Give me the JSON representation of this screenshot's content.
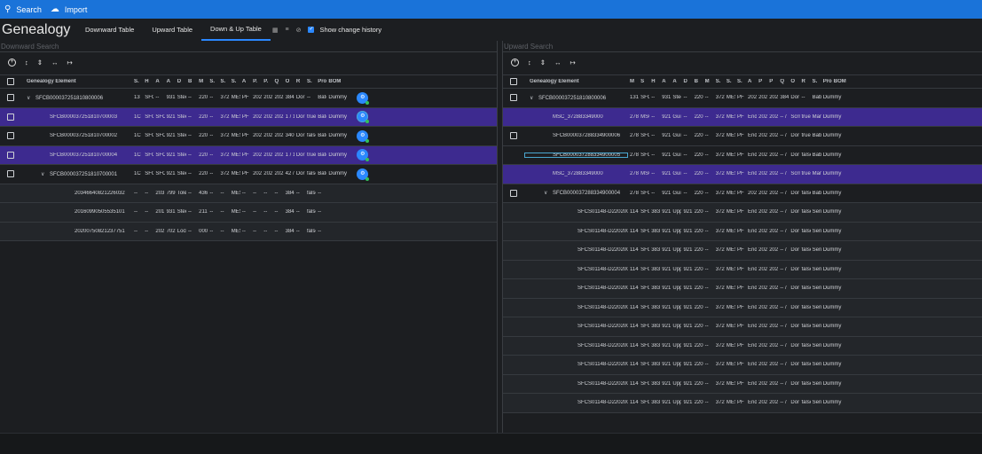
{
  "topbar": {
    "search_label": "Search",
    "import_label": "Import",
    "search_icon": "search-icon",
    "import_icon": "cloud-upload-icon"
  },
  "header": {
    "title": "Genealogy",
    "tabs": [
      "Downward Table",
      "Upward Table",
      "Down & Up Table"
    ],
    "active_tab": "Down & Up Table",
    "show_history_label": "Show change history",
    "show_history_checked": true
  },
  "colors": {
    "accent": "#1a73d9",
    "selected_row": "#3d2a8f",
    "bom_badge": "#2b88ff",
    "status_dot": "#33c25a"
  },
  "downward": {
    "search_placeholder": "Downward Search",
    "columns": [
      "Genealogy Element",
      "S.",
      "H",
      "A",
      "A",
      "D",
      "B",
      "M",
      "S.",
      "S.",
      "S.",
      "A",
      "P.",
      "P.",
      "Q",
      "O",
      "R",
      "S.",
      "Proc...",
      "BOM"
    ],
    "rows": [
      {
        "cells": [
          "SFCB000037251810800006",
          "13",
          "SFC",
          "--",
          "931",
          "Stee",
          "--",
          "220",
          "--",
          "372",
          "MES",
          "PF",
          "202",
          "202",
          "202",
          "384",
          "Dor",
          "--",
          "Batc",
          "Dummy"
        ],
        "expand": "v",
        "indent": 0,
        "selected": false,
        "checkbox": true
      },
      {
        "cells": [
          "SFCB000037251810700003",
          "1C",
          "SFC",
          "SFC",
          "921",
          "Stee",
          "--",
          "220",
          "--",
          "372",
          "MES",
          "PF",
          "202",
          "202",
          "202",
          "1 / 1",
          "Dor",
          "true",
          "Batc",
          "Dummy"
        ],
        "expand": "",
        "indent": 1,
        "selected": true,
        "checkbox": true
      },
      {
        "cells": [
          "SFCB000037251810700002",
          "1C",
          "SFC",
          "SFC",
          "921",
          "Stee",
          "--",
          "220",
          "--",
          "372",
          "MES",
          "PF",
          "202",
          "202",
          "202",
          "340",
          "Dor",
          "false",
          "Batc",
          "Dummy"
        ],
        "expand": "",
        "indent": 1,
        "selected": false,
        "checkbox": true
      },
      {
        "cells": [
          "SFCB000037251810700004",
          "1C",
          "SFC",
          "SFC",
          "921",
          "Stee",
          "--",
          "220",
          "--",
          "372",
          "MES",
          "PF",
          "202",
          "202",
          "202",
          "1 / 1",
          "Dor",
          "true",
          "Batc",
          "Dummy"
        ],
        "expand": "",
        "indent": 1,
        "selected": true,
        "checkbox": true
      },
      {
        "cells": [
          "SFCB000037251810700001",
          "1C",
          "SFC",
          "SFC",
          "921",
          "Stee",
          "--",
          "220",
          "--",
          "372",
          "MES",
          "PF",
          "202",
          "202",
          "202",
          "42 /",
          "Dor",
          "false",
          "Batc",
          "Dummy"
        ],
        "expand": "v",
        "indent": 1,
        "selected": false,
        "checkbox": true
      },
      {
        "cells": [
          "20346640821226032",
          "--",
          "--",
          "203",
          "799",
          "Tole",
          "--",
          "436",
          "--",
          "--",
          "MES",
          "--",
          "--",
          "--",
          "--",
          "384",
          "--",
          "false",
          "--",
          ""
        ],
        "expand": "",
        "indent": 2,
        "selected": false,
        "checkbox": false
      },
      {
        "cells": [
          "20160990505535101",
          "--",
          "--",
          "201",
          "931",
          "Stee",
          "--",
          "211",
          "--",
          "--",
          "MES",
          "--",
          "--",
          "--",
          "--",
          "384",
          "--",
          "false",
          "--",
          ""
        ],
        "expand": "",
        "indent": 2,
        "selected": false,
        "checkbox": false
      },
      {
        "cells": [
          "20200750821237751",
          "--",
          "--",
          "202",
          "702",
          "Locl",
          "--",
          "000",
          "--",
          "--",
          "MES",
          "--",
          "--",
          "--",
          "--",
          "384",
          "--",
          "false",
          "--",
          ""
        ],
        "expand": "",
        "indent": 2,
        "selected": false,
        "checkbox": false
      }
    ]
  },
  "upward": {
    "search_placeholder": "Upward Search",
    "columns": [
      "Genealogy Element",
      "M",
      "S",
      "H",
      "A",
      "A",
      "D",
      "B",
      "M",
      "S.",
      "S.",
      "S.",
      "A",
      "P",
      "P",
      "Q",
      "O",
      "R",
      "S.",
      "Proc...",
      "BOM"
    ],
    "rows": [
      {
        "cells": [
          "SFCB000037251810800006",
          "131",
          "SFC",
          "--",
          "931",
          "Stee",
          "--",
          "220",
          "--",
          "372",
          "MES",
          "PF",
          "202",
          "202",
          "202",
          "384",
          "Dor",
          "--",
          "Bab",
          "Dummy"
        ],
        "expand": "v",
        "indent": 0,
        "selected": false,
        "checkbox": true
      },
      {
        "cells": [
          "MSC_372883349000",
          "278",
          "MSC",
          "--",
          "921",
          "Guir",
          "--",
          "220",
          "--",
          "372",
          "MES",
          "PF",
          "End",
          "202",
          "202",
          "-- /",
          "Scrn",
          "true",
          "Man",
          "Dummy"
        ],
        "expand": "",
        "indent": 1,
        "selected": true,
        "checkbox": false
      },
      {
        "cells": [
          "SFCB000037288334900006",
          "278",
          "SFC",
          "--",
          "921",
          "Guir",
          "--",
          "220",
          "--",
          "372",
          "MES",
          "PF",
          "End",
          "202",
          "202",
          "-- /",
          "Dor",
          "true",
          "Bab",
          "Dummy"
        ],
        "expand": "",
        "indent": 1,
        "selected": false,
        "checkbox": true
      },
      {
        "cells": [
          "SFCB000037288334900005",
          "278",
          "SFC",
          "--",
          "921",
          "Guir",
          "--",
          "220",
          "--",
          "372",
          "MES",
          "PF",
          "End",
          "202",
          "202",
          "-- /",
          "Dor",
          "false",
          "Bab",
          "Dummy"
        ],
        "expand": "",
        "indent": 1,
        "selected": false,
        "checkbox": false
      },
      {
        "cells": [
          "MSC_372883349000",
          "278",
          "MSC",
          "--",
          "921",
          "Guir",
          "--",
          "220",
          "--",
          "372",
          "MES",
          "PF",
          "End",
          "202",
          "202",
          "-- /",
          "Scrn",
          "true",
          "Man",
          "Dummy"
        ],
        "expand": "",
        "indent": 1,
        "selected": true,
        "checkbox": false
      },
      {
        "cells": [
          "SFCB000037288334900004",
          "278",
          "SFC",
          "--",
          "921",
          "Guir",
          "--",
          "220",
          "--",
          "372",
          "MES",
          "PF",
          "202",
          "202",
          "202",
          "-- /",
          "Dor",
          "false",
          "Bab",
          "Dummy"
        ],
        "expand": "v",
        "indent": 1,
        "selected": false,
        "checkbox": true
      },
      {
        "cells": [
          "SFCS01148-D22020052",
          "114",
          "SFC",
          "383",
          "921",
          "Upp",
          "921",
          "220",
          "--",
          "372",
          "MES",
          "PF",
          "End",
          "202",
          "202",
          "-- /",
          "Dor",
          "false",
          "Seri",
          "Dummy"
        ],
        "expand": "",
        "indent": 2,
        "selected": false,
        "checkbox": false
      },
      {
        "cells": [
          "SFCS01148-D22020052",
          "114",
          "SFC",
          "383",
          "921",
          "Upp",
          "921",
          "220",
          "--",
          "372",
          "MES",
          "PF",
          "End",
          "202",
          "202",
          "-- /",
          "Dor",
          "false",
          "Seri",
          "Dummy"
        ],
        "expand": "",
        "indent": 2,
        "selected": false,
        "checkbox": false
      },
      {
        "cells": [
          "SFCS01148-D22020052",
          "114",
          "SFC",
          "383",
          "921",
          "Upp",
          "921",
          "220",
          "--",
          "372",
          "MES",
          "PF",
          "End",
          "202",
          "202",
          "-- /",
          "Dor",
          "false",
          "Seri",
          "Dummy"
        ],
        "expand": "",
        "indent": 2,
        "selected": false,
        "checkbox": false
      },
      {
        "cells": [
          "SFCS01148-D22020052",
          "114",
          "SFC",
          "383",
          "921",
          "Upp",
          "921",
          "220",
          "--",
          "372",
          "MES",
          "PF",
          "End",
          "202",
          "202",
          "-- /",
          "Dor",
          "false",
          "Seri",
          "Dummy"
        ],
        "expand": "",
        "indent": 2,
        "selected": false,
        "checkbox": false
      },
      {
        "cells": [
          "SFCS01148-D22020052",
          "114",
          "SFC",
          "383",
          "921",
          "Upp",
          "921",
          "220",
          "--",
          "372",
          "MES",
          "PF",
          "End",
          "202",
          "202",
          "-- /",
          "Dor",
          "false",
          "Seri",
          "Dummy"
        ],
        "expand": "",
        "indent": 2,
        "selected": false,
        "checkbox": false
      },
      {
        "cells": [
          "SFCS01148-D22020052",
          "114",
          "SFC",
          "383",
          "921",
          "Upp",
          "921",
          "220",
          "--",
          "372",
          "MES",
          "PF",
          "End",
          "202",
          "202",
          "-- /",
          "Dor",
          "false",
          "Seri",
          "Dummy"
        ],
        "expand": "",
        "indent": 2,
        "selected": false,
        "checkbox": false
      },
      {
        "cells": [
          "SFCS01148-D22020052",
          "114",
          "SFC",
          "383",
          "921",
          "Upp",
          "921",
          "220",
          "--",
          "372",
          "MES",
          "PF",
          "End",
          "202",
          "202",
          "-- /",
          "Dor",
          "false",
          "Seri",
          "Dummy"
        ],
        "expand": "",
        "indent": 2,
        "selected": false,
        "checkbox": false
      },
      {
        "cells": [
          "SFCS01148-D22020052",
          "114",
          "SFC",
          "383",
          "921",
          "Upp",
          "921",
          "220",
          "--",
          "372",
          "MES",
          "PF",
          "End",
          "202",
          "202",
          "-- /",
          "Dor",
          "false",
          "Seri",
          "Dummy"
        ],
        "expand": "",
        "indent": 2,
        "selected": false,
        "checkbox": false
      },
      {
        "cells": [
          "SFCS01148-D22020052",
          "114",
          "SFC",
          "383",
          "921",
          "Upp",
          "921",
          "220",
          "--",
          "372",
          "MES",
          "PF",
          "End",
          "202",
          "202",
          "-- /",
          "Dor",
          "false",
          "Seri",
          "Dummy"
        ],
        "expand": "",
        "indent": 2,
        "selected": false,
        "checkbox": false
      },
      {
        "cells": [
          "SFCS01148-D22020052",
          "114",
          "SFC",
          "383",
          "921",
          "Upp",
          "921",
          "220",
          "--",
          "372",
          "MES",
          "PF",
          "End",
          "202",
          "202",
          "-- /",
          "Dor",
          "false",
          "Seri",
          "Dummy"
        ],
        "expand": "",
        "indent": 2,
        "selected": false,
        "checkbox": false
      },
      {
        "cells": [
          "SFCS01148-D22020052",
          "114",
          "SFC",
          "383",
          "921",
          "Upp",
          "921",
          "220",
          "--",
          "372",
          "MES",
          "PF",
          "End",
          "202",
          "202",
          "-- /",
          "Dor",
          "false",
          "Seri",
          "Dummy"
        ],
        "expand": "",
        "indent": 2,
        "selected": false,
        "checkbox": false
      }
    ]
  }
}
